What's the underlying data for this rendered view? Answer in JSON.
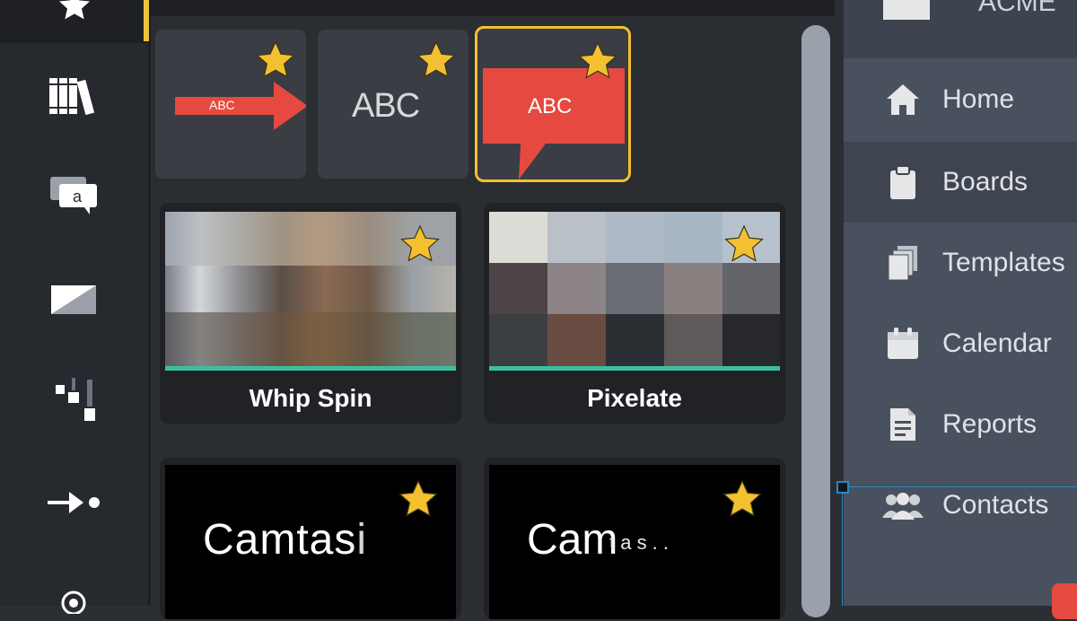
{
  "rail": {
    "icons": [
      "favorites-star-icon",
      "library-icon",
      "annotations-icon",
      "transitions-icon",
      "behaviors-icon",
      "animations-icon",
      "cursor-effects-icon"
    ]
  },
  "favorites": {
    "tiles": [
      {
        "name": "arrow-callout",
        "text": "ABC"
      },
      {
        "name": "text-callout",
        "text": "ABC"
      },
      {
        "name": "speech-callout",
        "text": "ABC"
      }
    ]
  },
  "transitions": [
    {
      "label": "Whip Spin"
    },
    {
      "label": "Pixelate"
    }
  ],
  "text_animations": [
    {
      "text": "Camtasi"
    },
    {
      "text_large": "Cam",
      "text_small": "t a s . ."
    }
  ],
  "nav": {
    "header": "ACME",
    "items": [
      {
        "label": "Home",
        "icon": "home-icon"
      },
      {
        "label": "Boards",
        "icon": "clipboard-icon"
      },
      {
        "label": "Templates",
        "icon": "templates-icon"
      },
      {
        "label": "Calendar",
        "icon": "calendar-icon"
      },
      {
        "label": "Reports",
        "icon": "reports-icon"
      },
      {
        "label": "Contacts",
        "icon": "contacts-icon"
      }
    ]
  },
  "colors": {
    "star": "#f3c130",
    "accent_yellow": "#f0c33c",
    "callout_red": "#e5493f",
    "teal": "#3bc0a3",
    "selection_blue": "#2a88c4"
  }
}
